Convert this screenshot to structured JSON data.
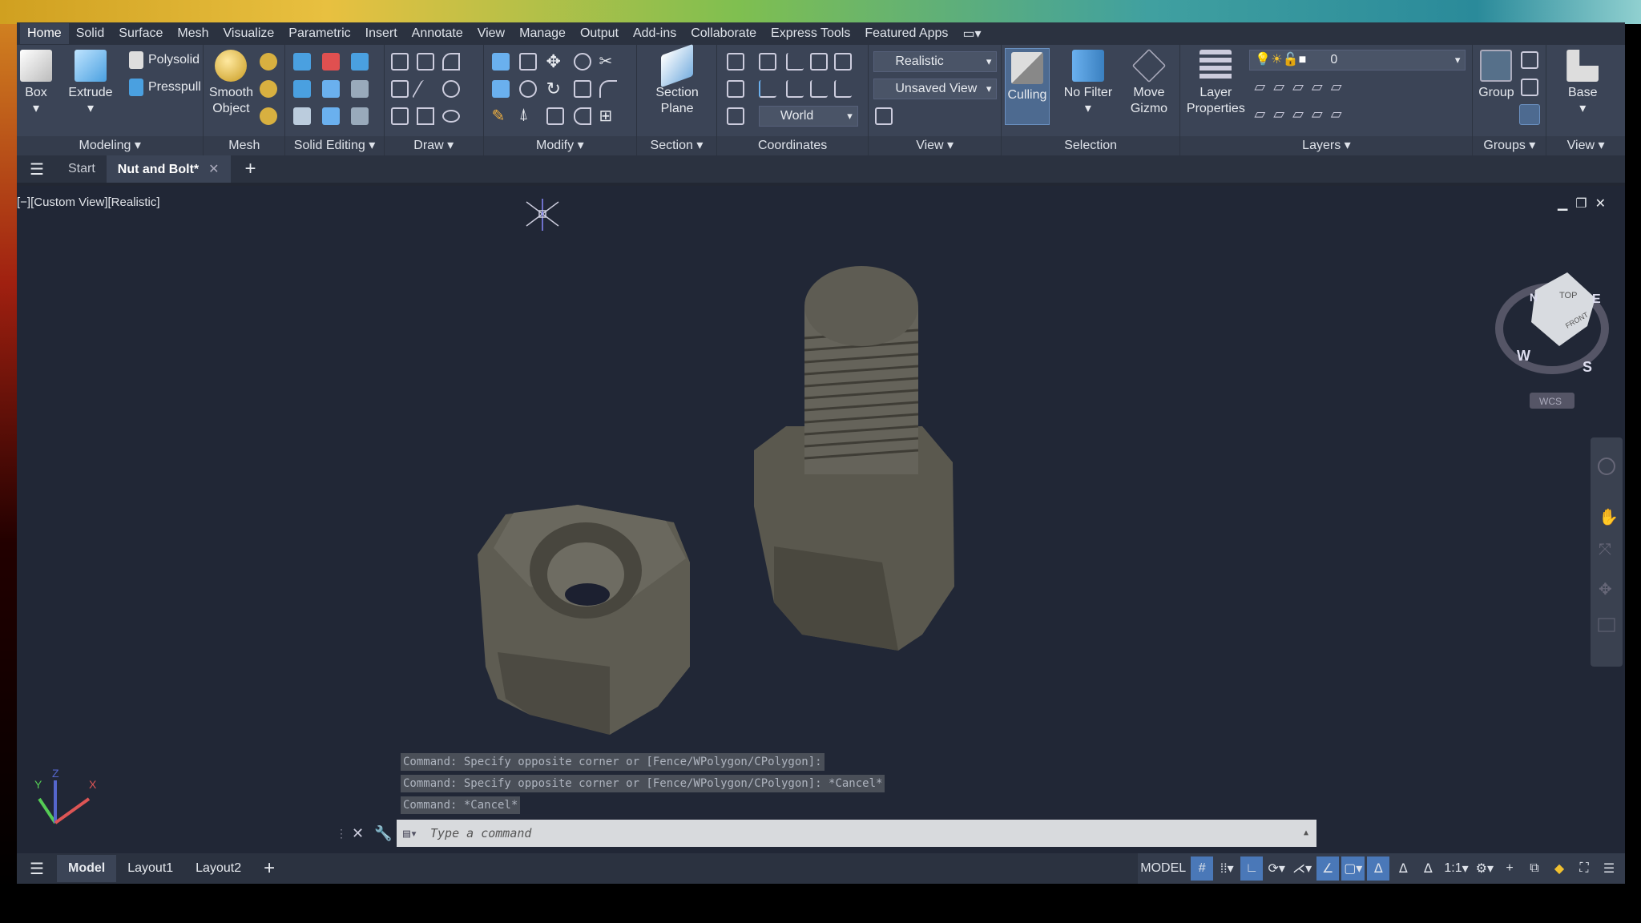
{
  "menu": {
    "tabs": [
      "Home",
      "Solid",
      "Surface",
      "Mesh",
      "Visualize",
      "Parametric",
      "Insert",
      "Annotate",
      "View",
      "Manage",
      "Output",
      "Add-ins",
      "Collaborate",
      "Express Tools",
      "Featured Apps"
    ]
  },
  "ribbon": {
    "modeling": {
      "box": "Box",
      "extrude": "Extrude",
      "polysolid": "Polysolid",
      "presspull": "Presspull",
      "label": "Modeling ▾"
    },
    "mesh": {
      "smooth": "Smooth",
      "object": "Object",
      "label": "Mesh"
    },
    "solid_editing": {
      "label": "Solid Editing ▾"
    },
    "draw": {
      "label": "Draw ▾"
    },
    "modify": {
      "label": "Modify ▾"
    },
    "section": {
      "line1": "Section",
      "line2": "Plane",
      "label": "Section ▾"
    },
    "coordinates": {
      "world": "World",
      "label": "Coordinates"
    },
    "view": {
      "visual_style": "Realistic",
      "named_view": "Unsaved View",
      "label": "View ▾"
    },
    "selection": {
      "culling": "Culling",
      "no_filter": "No Filter",
      "move": "Move",
      "gizmo": "Gizmo",
      "label": "Selection"
    },
    "layers": {
      "layer": "Layer",
      "properties": "Properties",
      "current_layer": "0",
      "label": "Layers ▾"
    },
    "groups": {
      "group": "Group",
      "label": "Groups ▾"
    },
    "view2": {
      "base": "Base",
      "label": "View ▾"
    }
  },
  "doctabs": {
    "start": "Start",
    "active": "Nut and Bolt*"
  },
  "viewport": {
    "label": "[−][Custom View][Realistic]",
    "wcs": "WCS",
    "compass": {
      "n": "N",
      "e": "E",
      "s": "S",
      "w": "W"
    },
    "cube_top": "TOP",
    "cube_front": "FRONT",
    "axes": {
      "x": "X",
      "y": "Y",
      "z": "Z"
    }
  },
  "command": {
    "history": [
      "Command: Specify opposite corner or [Fence/WPolygon/CPolygon]:",
      "Command: Specify opposite corner or [Fence/WPolygon/CPolygon]: *Cancel*",
      "Command: *Cancel*"
    ],
    "placeholder": "Type a command"
  },
  "status": {
    "layout_tabs": [
      "Model",
      "Layout1",
      "Layout2"
    ],
    "model": "MODEL",
    "scale": "1:1"
  }
}
